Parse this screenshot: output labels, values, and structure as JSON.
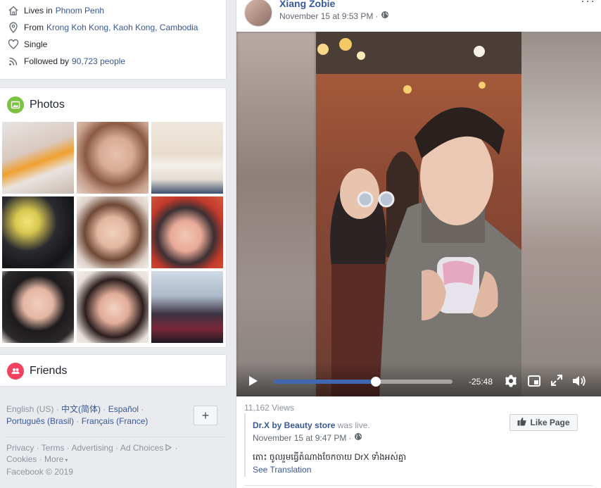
{
  "intro": {
    "lives_prefix": "Lives in",
    "lives_link": "Phnom Penh",
    "from_prefix": "From",
    "from_link": "Krong Koh Kong, Kaoh Kong, Cambodia",
    "relationship": "Single",
    "followed_prefix": "Followed by",
    "followed_link": "90,723 people"
  },
  "photos": {
    "title": "Photos"
  },
  "friends": {
    "title": "Friends"
  },
  "languages": {
    "current": "English (US)",
    "options": [
      "中文(简体)",
      "Español",
      "Português (Brasil)",
      "Français (France)"
    ],
    "add_label": "+"
  },
  "footer": {
    "links": [
      "Privacy",
      "Terms",
      "Advertising",
      "Ad Choices",
      "Cookies",
      "More"
    ],
    "copyright": "Facebook © 2019"
  },
  "post": {
    "author": "Xiang Zobie",
    "timestamp": "November 15 at 9:53 PM",
    "more_label": "···",
    "video": {
      "time_remaining": "-25:48",
      "progress": 0.57
    },
    "views": "11,162 Views",
    "shared": {
      "page_name": "Dr.X by Beauty store",
      "status": "was live.",
      "timestamp": "November 15 at 9:47 PM",
      "text": "តោះ ចូលរួមធ្វើតំណាងចែកចាយ DrX ទាំងអស់គ្នា",
      "see_translation": "See Translation",
      "like_page": "Like Page"
    }
  },
  "colors": {
    "link": "#385898",
    "accent": "#4267b2",
    "background": "#e9ebee"
  }
}
